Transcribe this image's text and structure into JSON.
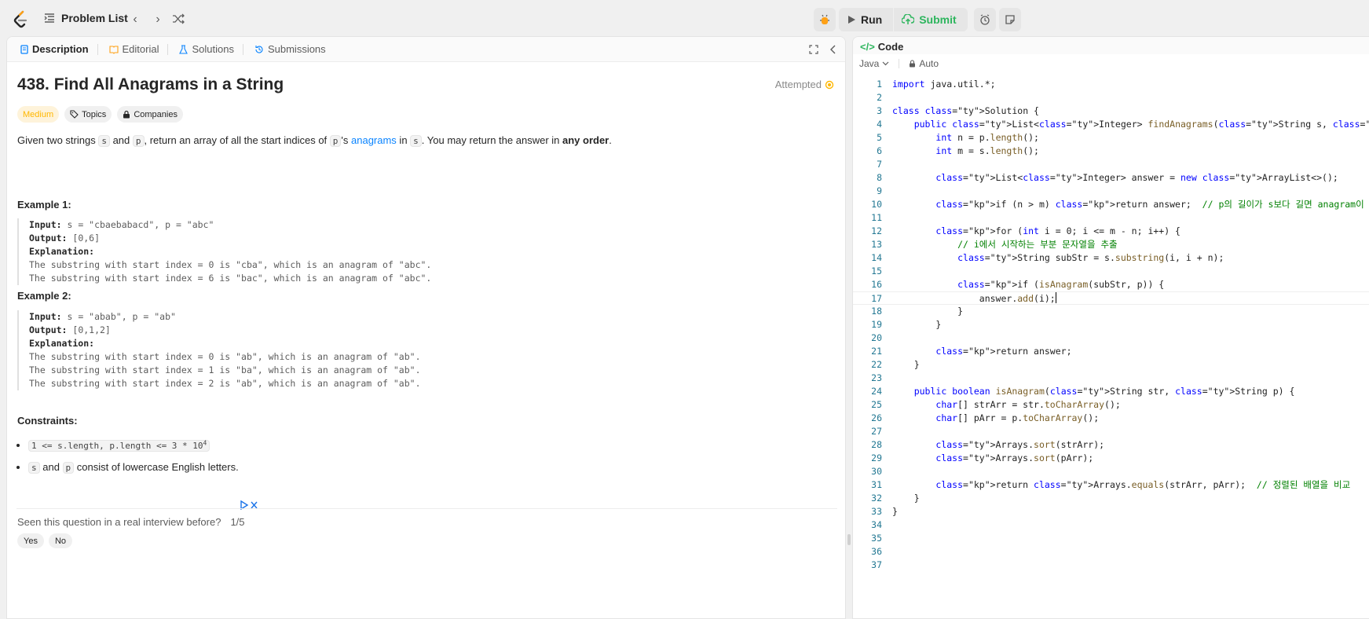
{
  "topbar": {
    "problem_list_label": "Problem List",
    "run_label": "Run",
    "submit_label": "Submit"
  },
  "left_tabs": [
    {
      "label": "Description"
    },
    {
      "label": "Editorial"
    },
    {
      "label": "Solutions"
    },
    {
      "label": "Submissions"
    }
  ],
  "problem": {
    "title": "438. Find All Anagrams in a String",
    "status": "Attempted",
    "difficulty": "Medium",
    "topics_label": "Topics",
    "companies_label": "Companies",
    "desc_1": "Given two strings ",
    "desc_s": "s",
    "desc_2": " and ",
    "desc_p": "p",
    "desc_3": ", return an array of all the start indices of ",
    "desc_p2": "p",
    "desc_4": "'s ",
    "desc_link": "anagrams",
    "desc_5": " in ",
    "desc_s2": "s",
    "desc_6": ". You may return the answer in ",
    "desc_bold": "any order",
    "desc_7": "."
  },
  "examples": [
    {
      "heading": "Example 1:",
      "input_label": "Input:",
      "input": " s = \"cbaebabacd\", p = \"abc\"",
      "output_label": "Output:",
      "output": " [0,6]",
      "explanation_label": "Explanation:",
      "explanation": [
        "The substring with start index = 0 is \"cba\", which is an anagram of \"abc\".",
        "The substring with start index = 6 is \"bac\", which is an anagram of \"abc\"."
      ]
    },
    {
      "heading": "Example 2:",
      "input_label": "Input:",
      "input": " s = \"abab\", p = \"ab\"",
      "output_label": "Output:",
      "output": " [0,1,2]",
      "explanation_label": "Explanation:",
      "explanation": [
        "The substring with start index = 0 is \"ab\", which is an anagram of \"ab\".",
        "The substring with start index = 1 is \"ba\", which is an anagram of \"ab\".",
        "The substring with start index = 2 is \"ab\", which is an anagram of \"ab\"."
      ]
    }
  ],
  "constraints": {
    "heading": "Constraints:",
    "c1_code": "1 <= s.length, p.length <= 3 * 10",
    "c1_sup": "4",
    "c2_s": "s",
    "c2_and": " and ",
    "c2_p": "p",
    "c2_rest": " consist of lowercase English letters."
  },
  "feedback": {
    "question": "Seen this question in a real interview before?",
    "count": "1/5",
    "yes": "Yes",
    "no": "No"
  },
  "code_panel": {
    "tab_label": "Code",
    "language": "Java",
    "mode": "Auto"
  },
  "code_lines": [
    "import java.util.*;",
    "",
    "class Solution {",
    "    public List<Integer> findAnagrams(String s, String p) {",
    "        int n = p.length();",
    "        int m = s.length();",
    "",
    "        List<Integer> answer = new ArrayList<>();",
    "",
    "        if (n > m) return answer;  // p의 길이가 s보다 길면 anagram이 존재할 수 없음",
    "",
    "        for (int i = 0; i <= m - n; i++) {",
    "            // i에서 시작하는 부분 문자열을 추출",
    "            String subStr = s.substring(i, i + n);",
    "",
    "            if (isAnagram(subStr, p)) {",
    "                answer.add(i);",
    "            }",
    "        }",
    "",
    "        return answer;",
    "    }",
    "",
    "    public boolean isAnagram(String str, String p) {",
    "        char[] strArr = str.toCharArray();",
    "        char[] pArr = p.toCharArray();",
    "",
    "        Arrays.sort(strArr);",
    "        Arrays.sort(pArr);",
    "",
    "        return Arrays.equals(strArr, pArr);  // 정렬된 배열을 비교",
    "    }",
    "}",
    "",
    "",
    "",
    ""
  ]
}
